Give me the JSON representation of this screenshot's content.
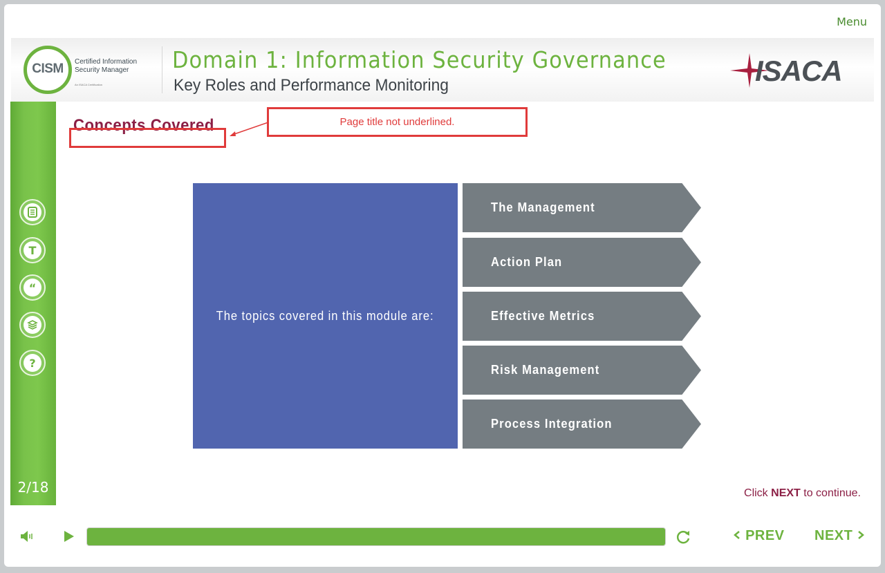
{
  "menu": {
    "label": "Menu"
  },
  "header": {
    "logo_badge": "CISM",
    "logo_line1": "Certified Information",
    "logo_line2": "Security Manager",
    "logo_tagline": "An ISACA Certification",
    "title": "Domain 1: Information Security Governance",
    "subtitle": "Key Roles and Performance Monitoring",
    "brand": "ISACA"
  },
  "sidebar": {
    "items": [
      {
        "icon": "notes-icon",
        "glyph": "≣"
      },
      {
        "icon": "transcript-icon",
        "glyph": "T"
      },
      {
        "icon": "quote-icon",
        "glyph": "“"
      },
      {
        "icon": "resources-icon",
        "glyph": "◈"
      },
      {
        "icon": "help-icon",
        "glyph": "?"
      }
    ],
    "page_indicator": "2/18"
  },
  "content": {
    "page_title": "Concepts Covered",
    "annotation": "Page title not underlined.",
    "intro": "The topics covered in this module are:",
    "topics": [
      "The Management",
      "Action Plan",
      "Effective Metrics",
      "Risk Management",
      "Process Integration"
    ],
    "instruction_prefix": "Click",
    "instruction_strong": "NEXT",
    "instruction_suffix": "to continue."
  },
  "player": {
    "progress": 1.0,
    "prev_label": "PREV",
    "next_label": "NEXT",
    "accent_color": "#6db33f"
  }
}
